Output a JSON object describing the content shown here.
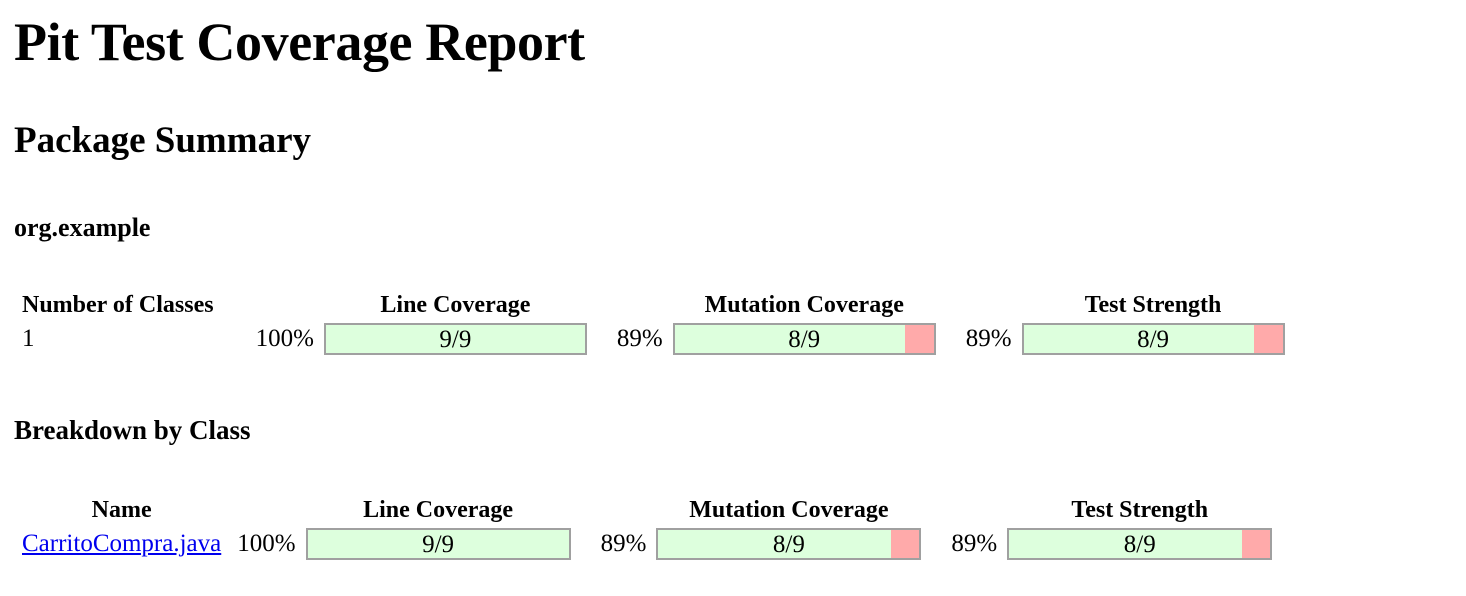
{
  "page": {
    "title": "Pit Test Coverage Report",
    "section_package_summary": "Package Summary",
    "package_name": "org.example",
    "section_breakdown": "Breakdown by Class"
  },
  "colors": {
    "covered": "#ddffdd",
    "uncovered": "#ffaaaa",
    "bar_border": "#a0a0a0",
    "link": "#0000ee",
    "text": "#000000",
    "background": "#ffffff"
  },
  "package_summary": {
    "headers": {
      "number_of_classes": "Number of Classes",
      "line_coverage": "Line Coverage",
      "mutation_coverage": "Mutation Coverage",
      "test_strength": "Test Strength"
    },
    "row": {
      "number_of_classes": "1",
      "line_coverage": {
        "percent_label": "100%",
        "ratio_label": "9/9",
        "percent_value": 100,
        "covered": 9,
        "total": 9
      },
      "mutation_coverage": {
        "percent_label": "89%",
        "ratio_label": "8/9",
        "percent_value": 89,
        "covered": 8,
        "total": 9
      },
      "test_strength": {
        "percent_label": "89%",
        "ratio_label": "8/9",
        "percent_value": 89,
        "covered": 8,
        "total": 9
      }
    }
  },
  "breakdown_by_class": {
    "headers": {
      "name": "Name",
      "line_coverage": "Line Coverage",
      "mutation_coverage": "Mutation Coverage",
      "test_strength": "Test Strength"
    },
    "rows": [
      {
        "name": "CarritoCompra.java",
        "line_coverage": {
          "percent_label": "100%",
          "ratio_label": "9/9",
          "percent_value": 100,
          "covered": 9,
          "total": 9
        },
        "mutation_coverage": {
          "percent_label": "89%",
          "ratio_label": "8/9",
          "percent_value": 89,
          "covered": 8,
          "total": 9
        },
        "test_strength": {
          "percent_label": "89%",
          "ratio_label": "8/9",
          "percent_value": 89,
          "covered": 8,
          "total": 9
        }
      }
    ]
  }
}
